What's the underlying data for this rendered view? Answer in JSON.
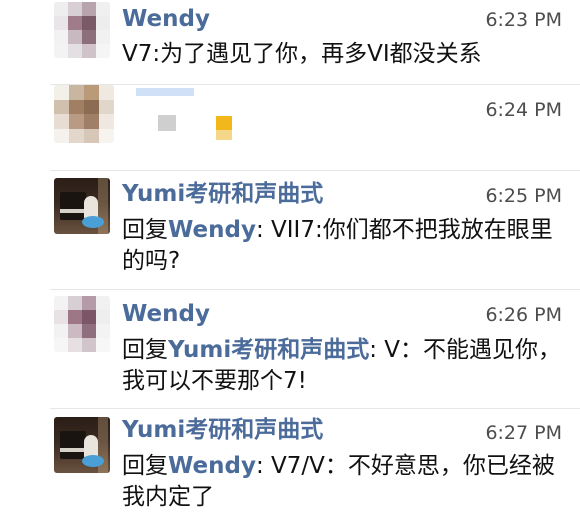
{
  "messages": [
    {
      "sender": "Wendy",
      "time": "6:23 PM",
      "text": "V7:为了遇见了你，再多VI都没关系"
    },
    {
      "sender": "",
      "time": "6:24 PM",
      "text": ""
    },
    {
      "sender": "Yumi考研和声曲式",
      "time": "6:25 PM",
      "reply_prefix": "回复",
      "reply_target": "Wendy",
      "reply_body": ": VII7:你们都不把我放在眼里的吗?"
    },
    {
      "sender": "Wendy",
      "time": "6:26 PM",
      "reply_prefix": "回复",
      "reply_target": "Yumi考研和声曲式",
      "reply_body": ": V：不能遇见你，我可以不要那个7!"
    },
    {
      "sender": "Yumi考研和声曲式",
      "time": "6:27 PM",
      "reply_prefix": "回复",
      "reply_target": "Wendy",
      "reply_body": ": V7/V：不好意思，你已经被我内定了"
    }
  ],
  "colors": {
    "name": "#4b6b9a",
    "text": "#111111",
    "time": "#4d4d4d",
    "divider": "#e6e6e6"
  }
}
